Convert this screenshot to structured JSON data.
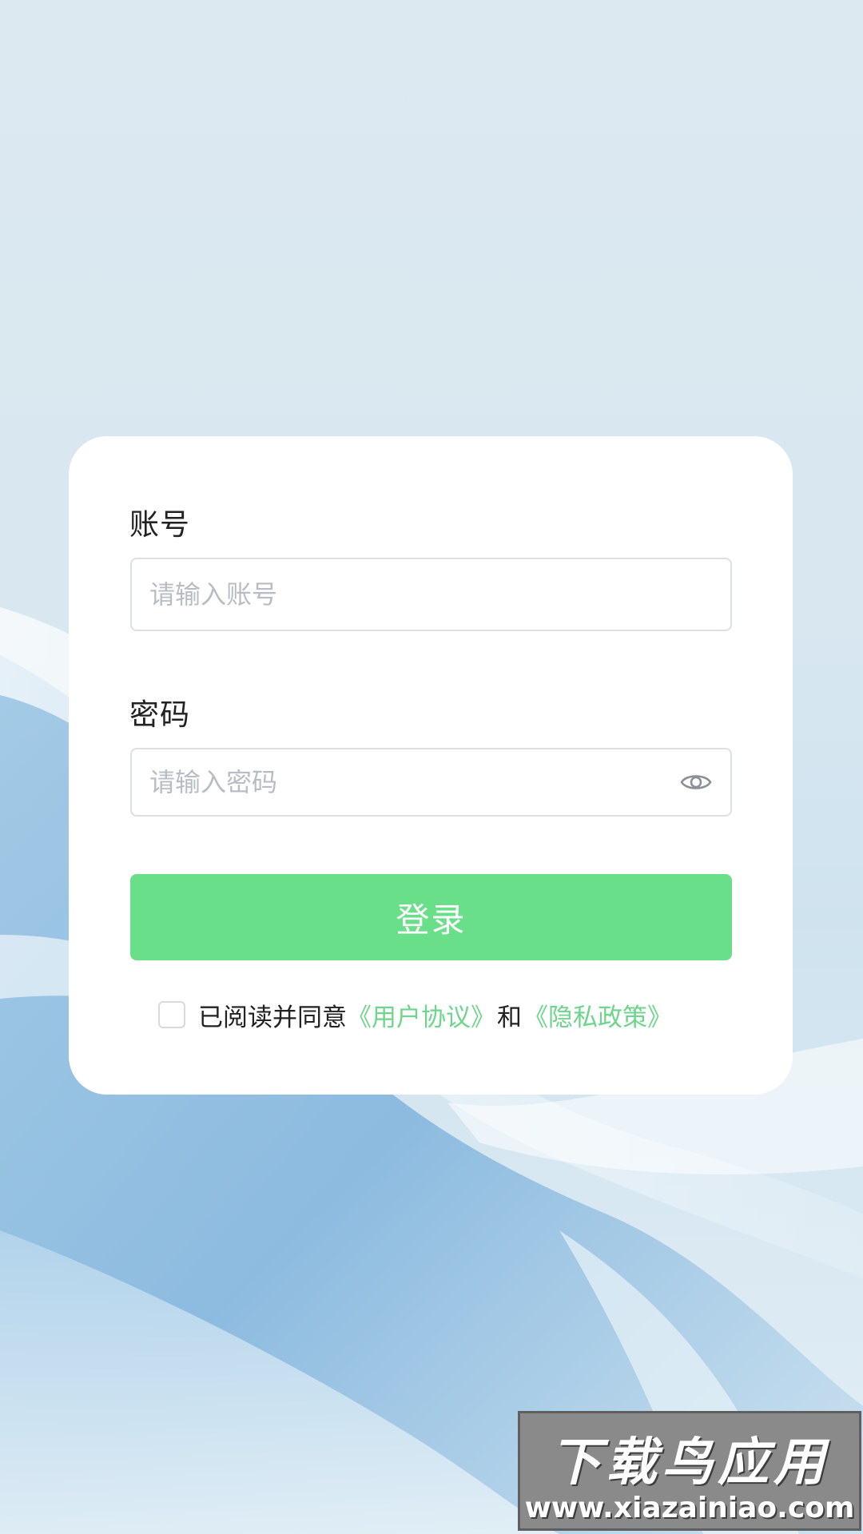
{
  "form": {
    "account_label": "账号",
    "account_placeholder": "请输入账号",
    "password_label": "密码",
    "password_placeholder": "请输入密码",
    "password_toggle_icon": "eye-icon",
    "login_label": "登录"
  },
  "agreement": {
    "checked": false,
    "prefix": "已阅读并同意",
    "user_agreement": "《用户协议》",
    "and_text": "和",
    "privacy_policy": "《隐私政策》"
  },
  "watermark": {
    "title": "下载鸟应用",
    "url": "www.xiazainiao.com"
  },
  "colors": {
    "primary_green": "#68df88",
    "link_green": "#6ed58c",
    "background_blue": "#dce9f1"
  }
}
